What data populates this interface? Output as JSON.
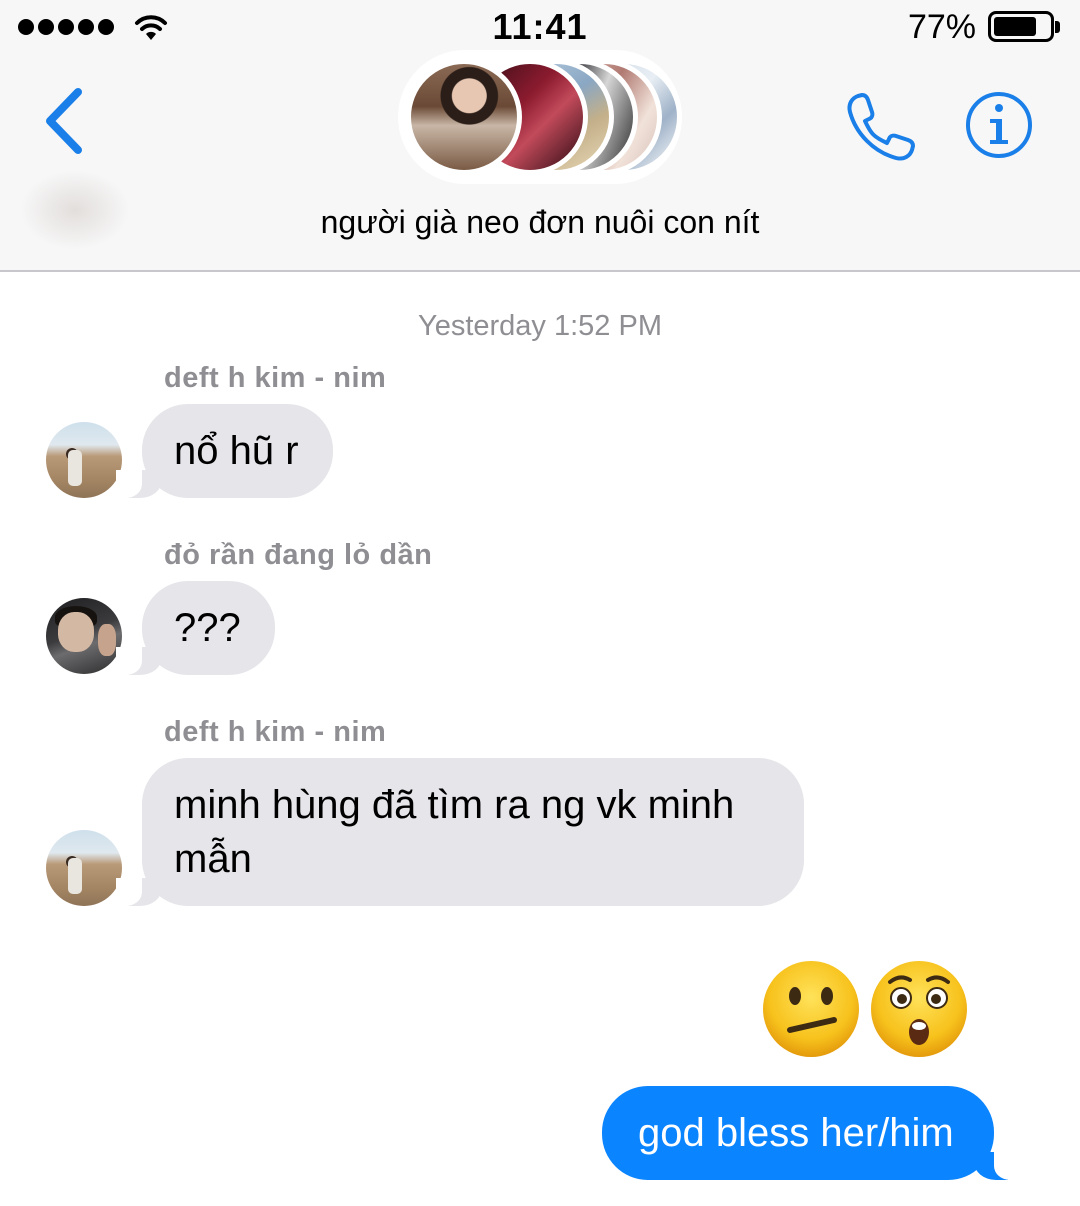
{
  "status_bar": {
    "time": "11:41",
    "battery_percent_label": "77%",
    "battery_level": 0.77,
    "signal_icon": "signal-dots-icon",
    "wifi_icon": "wifi-icon"
  },
  "header": {
    "back_icon": "chevron-left-icon",
    "call_icon": "phone-icon",
    "info_icon": "info-icon",
    "group_name": "người già neo đơn nuôi con nít",
    "accent_color": "#1a7fe8"
  },
  "conversation": {
    "timestamp": "Yesterday 1:52 PM",
    "messages": [
      {
        "sender": "deft h kim - nim",
        "text": "nổ hũ r",
        "direction": "incoming"
      },
      {
        "sender": "đỏ rần đang lỏ dần",
        "text": "???",
        "direction": "incoming"
      },
      {
        "sender": "deft h kim - nim",
        "text": "minh hùng đã tìm ra ng vk minh mẫn",
        "direction": "incoming"
      },
      {
        "sender": "",
        "text": "😕😲",
        "direction": "outgoing",
        "kind": "emoji",
        "emoji_names": [
          "confused-face",
          "hushed-face"
        ]
      },
      {
        "sender": "",
        "text": "god bless her/him",
        "direction": "outgoing"
      }
    ],
    "incoming_bubble_color": "#e5e5ea",
    "outgoing_bubble_color": "#0a84ff"
  }
}
